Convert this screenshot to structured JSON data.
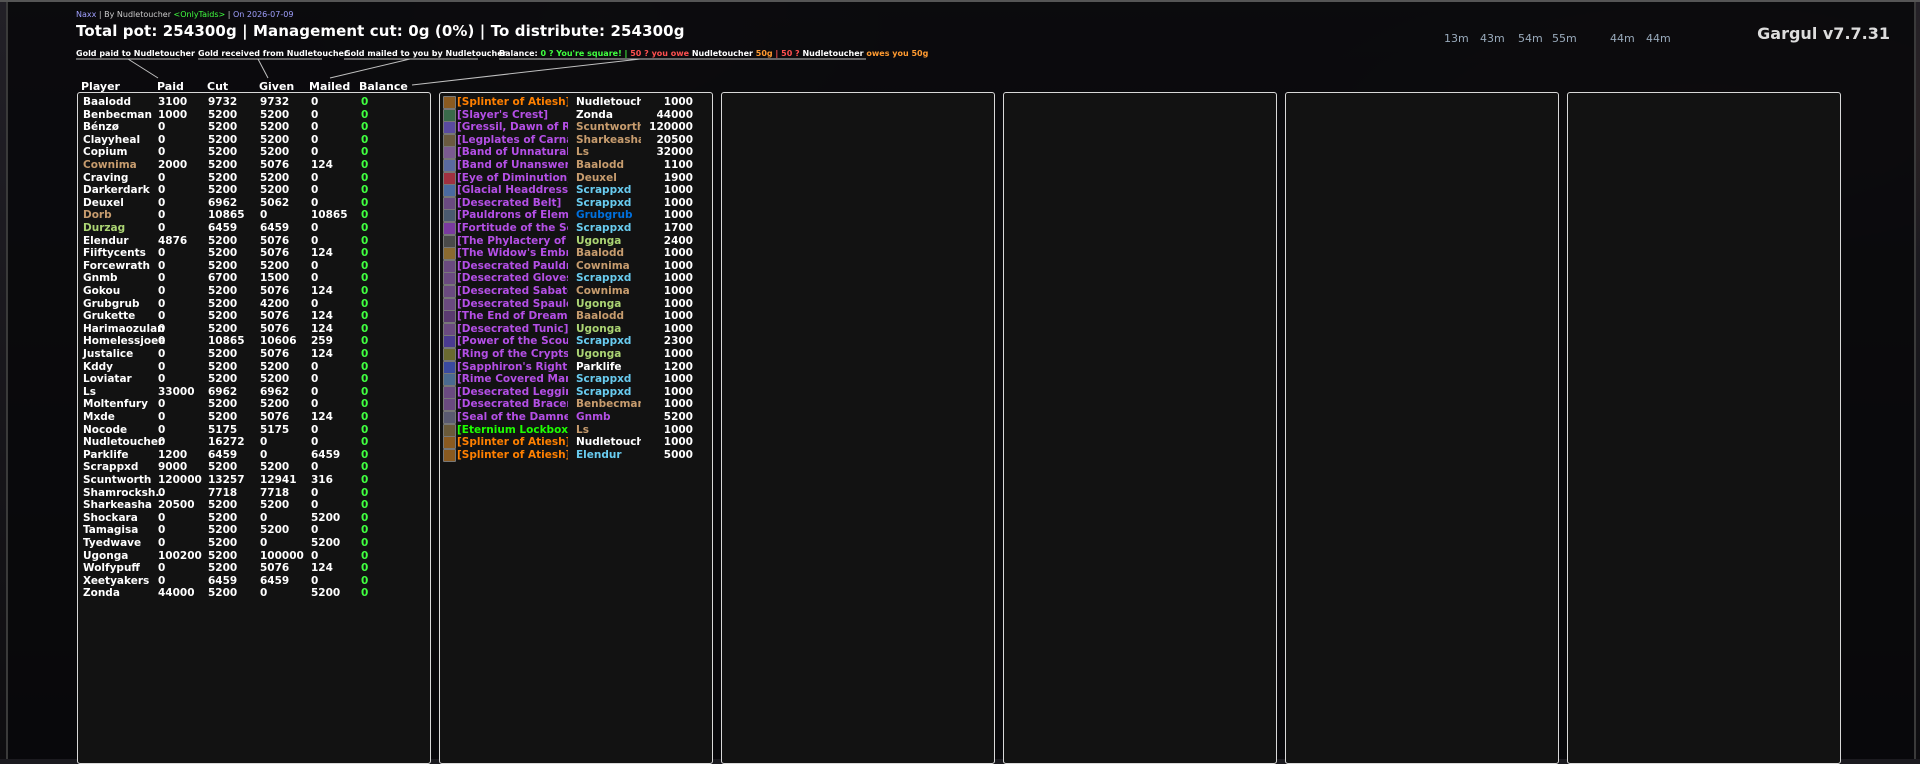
{
  "meta": {
    "raid": "Naxx",
    "sep1": " | ",
    "by_label": "By ",
    "author": "Nudletoucher ",
    "guild": "<OnlyTaids>",
    "sep2": " | ",
    "date": "On 2026-07-09"
  },
  "summary": "Total pot: 254300g | Management cut: 0g (0%) | To distribute: 254300g",
  "version": "Gargul v7.7.31",
  "buffs": [
    "13m",
    "43m",
    "54m",
    "55m",
    "44m",
    "44m"
  ],
  "legend": {
    "paid": "Gold paid to Nudletoucher",
    "received": "Gold received from Nudletoucher",
    "mailed": "Gold mailed to you by Nudletoucher",
    "balance_label": "Balance: ",
    "square": "0 ? You're square! | ",
    "you_owe": "50 ? you owe ",
    "owe_name": "Nudletoucher",
    "owe_amount": " 50g",
    "owes_you": " | 50 ? ",
    "owes_name": "Nudletoucher",
    "owes_text": " owes you 50g"
  },
  "columns": {
    "player": "Player",
    "paid": "Paid",
    "cut": "Cut",
    "given": "Given",
    "mailed": "Mailed",
    "balance": "Balance"
  },
  "colors": {
    "white": "#ffffff",
    "epic": "#b44fe6",
    "legendary": "#ff8000",
    "uncommon": "#1eff00",
    "mage": "#69ccf0",
    "rogue": "#fff569",
    "warrior": "#c79c6e",
    "paladin": "#f58cba",
    "druid": "#ff7d0a",
    "hunter": "#abd473",
    "shaman": "#0070de",
    "priest": "#ffffff"
  },
  "players": [
    {
      "name": "Baalodd",
      "paid": "3100",
      "cut": "9732",
      "given": "9732",
      "mailed": "0",
      "balance": "0",
      "color": "#ffffff"
    },
    {
      "name": "Benbecman",
      "paid": "1000",
      "cut": "5200",
      "given": "5200",
      "mailed": "0",
      "balance": "0",
      "color": "#ffffff"
    },
    {
      "name": "Bénzø",
      "paid": "0",
      "cut": "5200",
      "given": "5200",
      "mailed": "0",
      "balance": "0",
      "color": "#ffffff"
    },
    {
      "name": "Clayyheal",
      "paid": "0",
      "cut": "5200",
      "given": "5200",
      "mailed": "0",
      "balance": "0",
      "color": "#ffffff"
    },
    {
      "name": "Copium",
      "paid": "0",
      "cut": "5200",
      "given": "5200",
      "mailed": "0",
      "balance": "0",
      "color": "#ffffff"
    },
    {
      "name": "Cownima",
      "paid": "2000",
      "cut": "5200",
      "given": "5076",
      "mailed": "124",
      "balance": "0",
      "color": "#c79c6e"
    },
    {
      "name": "Craving",
      "paid": "0",
      "cut": "5200",
      "given": "5200",
      "mailed": "0",
      "balance": "0",
      "color": "#ffffff"
    },
    {
      "name": "Darkerdark",
      "paid": "0",
      "cut": "5200",
      "given": "5200",
      "mailed": "0",
      "balance": "0",
      "color": "#ffffff"
    },
    {
      "name": "Deuxel",
      "paid": "0",
      "cut": "6962",
      "given": "5062",
      "mailed": "0",
      "balance": "0",
      "color": "#ffffff"
    },
    {
      "name": "Dorb",
      "paid": "0",
      "cut": "10865",
      "given": "0",
      "mailed": "10865",
      "balance": "0",
      "color": "#c79c6e"
    },
    {
      "name": "Durzag",
      "paid": "0",
      "cut": "6459",
      "given": "6459",
      "mailed": "0",
      "balance": "0",
      "color": "#abd473"
    },
    {
      "name": "Elendur",
      "paid": "4876",
      "cut": "5200",
      "given": "5076",
      "mailed": "0",
      "balance": "0",
      "color": "#ffffff"
    },
    {
      "name": "Fiiftycents",
      "paid": "0",
      "cut": "5200",
      "given": "5076",
      "mailed": "124",
      "balance": "0",
      "color": "#ffffff"
    },
    {
      "name": "Forcewrath",
      "paid": "0",
      "cut": "5200",
      "given": "5200",
      "mailed": "0",
      "balance": "0",
      "color": "#ffffff"
    },
    {
      "name": "Gnmb",
      "paid": "0",
      "cut": "6700",
      "given": "1500",
      "mailed": "0",
      "balance": "0",
      "color": "#ffffff"
    },
    {
      "name": "Gokou",
      "paid": "0",
      "cut": "5200",
      "given": "5076",
      "mailed": "124",
      "balance": "0",
      "color": "#ffffff"
    },
    {
      "name": "Grubgrub",
      "paid": "0",
      "cut": "5200",
      "given": "4200",
      "mailed": "0",
      "balance": "0",
      "color": "#ffffff"
    },
    {
      "name": "Grukette",
      "paid": "0",
      "cut": "5200",
      "given": "5076",
      "mailed": "124",
      "balance": "0",
      "color": "#ffffff"
    },
    {
      "name": "Harimaozulan",
      "paid": "0",
      "cut": "5200",
      "given": "5076",
      "mailed": "124",
      "balance": "0",
      "color": "#ffffff"
    },
    {
      "name": "Homelessjoee",
      "paid": "0",
      "cut": "10865",
      "given": "10606",
      "mailed": "259",
      "balance": "0",
      "color": "#ffffff"
    },
    {
      "name": "Justalice",
      "paid": "0",
      "cut": "5200",
      "given": "5076",
      "mailed": "124",
      "balance": "0",
      "color": "#ffffff"
    },
    {
      "name": "Kddy",
      "paid": "0",
      "cut": "5200",
      "given": "5200",
      "mailed": "0",
      "balance": "0",
      "color": "#ffffff"
    },
    {
      "name": "Loviatar",
      "paid": "0",
      "cut": "5200",
      "given": "5200",
      "mailed": "0",
      "balance": "0",
      "color": "#ffffff"
    },
    {
      "name": "Ls",
      "paid": "33000",
      "cut": "6962",
      "given": "6962",
      "mailed": "0",
      "balance": "0",
      "color": "#ffffff"
    },
    {
      "name": "Moltenfury",
      "paid": "0",
      "cut": "5200",
      "given": "5200",
      "mailed": "0",
      "balance": "0",
      "color": "#ffffff"
    },
    {
      "name": "Mxde",
      "paid": "0",
      "cut": "5200",
      "given": "5076",
      "mailed": "124",
      "balance": "0",
      "color": "#ffffff"
    },
    {
      "name": "Nocode",
      "paid": "0",
      "cut": "5175",
      "given": "5175",
      "mailed": "0",
      "balance": "0",
      "color": "#ffffff"
    },
    {
      "name": "Nudletoucher",
      "paid": "0",
      "cut": "16272",
      "given": "0",
      "mailed": "0",
      "balance": "0",
      "color": "#ffffff"
    },
    {
      "name": "Parklife",
      "paid": "1200",
      "cut": "6459",
      "given": "0",
      "mailed": "6459",
      "balance": "0",
      "color": "#ffffff"
    },
    {
      "name": "Scrappxd",
      "paid": "9000",
      "cut": "5200",
      "given": "5200",
      "mailed": "0",
      "balance": "0",
      "color": "#ffffff"
    },
    {
      "name": "Scuntworth",
      "paid": "120000",
      "cut": "13257",
      "given": "12941",
      "mailed": "316",
      "balance": "0",
      "color": "#ffffff"
    },
    {
      "name": "Shamrocksh..",
      "paid": "0",
      "cut": "7718",
      "given": "7718",
      "mailed": "0",
      "balance": "0",
      "color": "#ffffff"
    },
    {
      "name": "Sharkeasha",
      "paid": "20500",
      "cut": "5200",
      "given": "5200",
      "mailed": "0",
      "balance": "0",
      "color": "#ffffff"
    },
    {
      "name": "Shockara",
      "paid": "0",
      "cut": "5200",
      "given": "0",
      "mailed": "5200",
      "balance": "0",
      "color": "#ffffff"
    },
    {
      "name": "Tamagisa",
      "paid": "0",
      "cut": "5200",
      "given": "5200",
      "mailed": "0",
      "balance": "0",
      "color": "#ffffff"
    },
    {
      "name": "Tyedwave",
      "paid": "0",
      "cut": "5200",
      "given": "0",
      "mailed": "5200",
      "balance": "0",
      "color": "#ffffff"
    },
    {
      "name": "Ugonga",
      "paid": "100200",
      "cut": "5200",
      "given": "100000",
      "mailed": "0",
      "balance": "0",
      "color": "#ffffff"
    },
    {
      "name": "Wolfypuff",
      "paid": "0",
      "cut": "5200",
      "given": "5076",
      "mailed": "124",
      "balance": "0",
      "color": "#ffffff"
    },
    {
      "name": "Xeetyakers",
      "paid": "0",
      "cut": "6459",
      "given": "6459",
      "mailed": "0",
      "balance": "0",
      "color": "#ffffff"
    },
    {
      "name": "Zonda",
      "paid": "44000",
      "cut": "5200",
      "given": "0",
      "mailed": "5200",
      "balance": "0",
      "color": "#ffffff"
    }
  ],
  "items": [
    {
      "item": "[Splinter of Atiesh]",
      "winner": "Nudletouch..",
      "price": "1000",
      "item_color": "#ff8000",
      "winner_color": "#ffffff",
      "icon": "#8a5a20"
    },
    {
      "item": "[Slayer's Crest]",
      "winner": "Zonda",
      "price": "44000",
      "item_color": "#b44fe6",
      "winner_color": "#ffffff",
      "icon": "#3a6a4a"
    },
    {
      "item": "[Gressil, Dawn of Rui..",
      "winner": "Scuntworth",
      "price": "120000",
      "item_color": "#b44fe6",
      "winner_color": "#c79c6e",
      "icon": "#5a4aa0"
    },
    {
      "item": "[Legplates of Carnag..",
      "winner": "Sharkeasha",
      "price": "20500",
      "item_color": "#b44fe6",
      "winner_color": "#c79c6e",
      "icon": "#6a5a40"
    },
    {
      "item": "[Band of Unnatural F..",
      "winner": "Ls",
      "price": "32000",
      "item_color": "#b44fe6",
      "winner_color": "#c79c6e",
      "icon": "#7a5a90"
    },
    {
      "item": "[Band of Unanswered..",
      "winner": "Baalodd",
      "price": "1100",
      "item_color": "#b44fe6",
      "winner_color": "#c79c6e",
      "icon": "#5a6aa0"
    },
    {
      "item": "[Eye of Diminution]",
      "winner": "Deuxel",
      "price": "1900",
      "item_color": "#b44fe6",
      "winner_color": "#c79c6e",
      "icon": "#a03040"
    },
    {
      "item": "[Glacial Headdress]",
      "winner": "Scrappxd",
      "price": "1000",
      "item_color": "#b44fe6",
      "winner_color": "#69ccf0",
      "icon": "#4a6aa0"
    },
    {
      "item": "[Desecrated Belt]",
      "winner": "Scrappxd",
      "price": "1000",
      "item_color": "#b44fe6",
      "winner_color": "#69ccf0",
      "icon": "#6a4a80"
    },
    {
      "item": "[Pauldrons of Elemen..",
      "winner": "Grubgrub",
      "price": "1000",
      "item_color": "#b44fe6",
      "winner_color": "#0070de",
      "icon": "#4a5a70"
    },
    {
      "item": "[Fortitude of the Sco..",
      "winner": "Scrappxd",
      "price": "1700",
      "item_color": "#b44fe6",
      "winner_color": "#69ccf0",
      "icon": "#7a3aa0"
    },
    {
      "item": "[The Phylactery of K..",
      "winner": "Ugonga",
      "price": "2400",
      "item_color": "#b44fe6",
      "winner_color": "#abd473",
      "icon": "#4a4a4a"
    },
    {
      "item": "[The Widow's Embra..",
      "winner": "Baalodd",
      "price": "1000",
      "item_color": "#b44fe6",
      "winner_color": "#c79c6e",
      "icon": "#8a6a30"
    },
    {
      "item": "[Desecrated Pauldro..",
      "winner": "Cownima",
      "price": "1000",
      "item_color": "#b44fe6",
      "winner_color": "#c79c6e",
      "icon": "#6a4a80"
    },
    {
      "item": "[Desecrated Gloves]",
      "winner": "Scrappxd",
      "price": "1000",
      "item_color": "#b44fe6",
      "winner_color": "#69ccf0",
      "icon": "#6a4a80"
    },
    {
      "item": "[Desecrated Sabaton..",
      "winner": "Cownima",
      "price": "1000",
      "item_color": "#b44fe6",
      "winner_color": "#c79c6e",
      "icon": "#6a4a80"
    },
    {
      "item": "[Desecrated Spaulde..",
      "winner": "Ugonga",
      "price": "1000",
      "item_color": "#b44fe6",
      "winner_color": "#abd473",
      "icon": "#6a4a80"
    },
    {
      "item": "[The End of Dreams]",
      "winner": "Baalodd",
      "price": "1000",
      "item_color": "#b44fe6",
      "winner_color": "#c79c6e",
      "icon": "#5a3a70"
    },
    {
      "item": "[Desecrated Tunic]",
      "winner": "Ugonga",
      "price": "1000",
      "item_color": "#b44fe6",
      "winner_color": "#abd473",
      "icon": "#6a4a80"
    },
    {
      "item": "[Power of the Scourg..",
      "winner": "Scrappxd",
      "price": "2300",
      "item_color": "#b44fe6",
      "winner_color": "#69ccf0",
      "icon": "#4a3a90"
    },
    {
      "item": "[Ring of the Cryptsta..",
      "winner": "Ugonga",
      "price": "1000",
      "item_color": "#b44fe6",
      "winner_color": "#abd473",
      "icon": "#6a6a30"
    },
    {
      "item": "[Sapphiron's Right E..",
      "winner": "Parklife",
      "price": "1200",
      "item_color": "#b44fe6",
      "winner_color": "#ffffff",
      "icon": "#3a4aa0"
    },
    {
      "item": "[Rime Covered Mantl..",
      "winner": "Scrappxd",
      "price": "1000",
      "item_color": "#b44fe6",
      "winner_color": "#69ccf0",
      "icon": "#4a6a90"
    },
    {
      "item": "[Desecrated Leggings]",
      "winner": "Scrappxd",
      "price": "1000",
      "item_color": "#b44fe6",
      "winner_color": "#69ccf0",
      "icon": "#6a4a80"
    },
    {
      "item": "[Desecrated Bracers]",
      "winner": "Benbecman",
      "price": "1000",
      "item_color": "#b44fe6",
      "winner_color": "#c79c6e",
      "icon": "#6a4a80"
    },
    {
      "item": "[Seal of the Damned]",
      "winner": "Gnmb",
      "price": "5200",
      "item_color": "#b44fe6",
      "winner_color": "#b44fe6",
      "icon": "#5a5a70"
    },
    {
      "item": "[Eternium Lockbox]",
      "winner": "Ls",
      "price": "1000",
      "item_color": "#1eff00",
      "winner_color": "#c79c6e",
      "icon": "#6a5a3a"
    },
    {
      "item": "[Splinter of Atiesh]",
      "winner": "Nudletouch..",
      "price": "1000",
      "item_color": "#ff8000",
      "winner_color": "#ffffff",
      "icon": "#8a5a20"
    },
    {
      "item": "[Splinter of Atiesh]",
      "winner": "Elendur",
      "price": "5000",
      "item_color": "#ff8000",
      "winner_color": "#69ccf0",
      "icon": "#8a5a20"
    }
  ]
}
